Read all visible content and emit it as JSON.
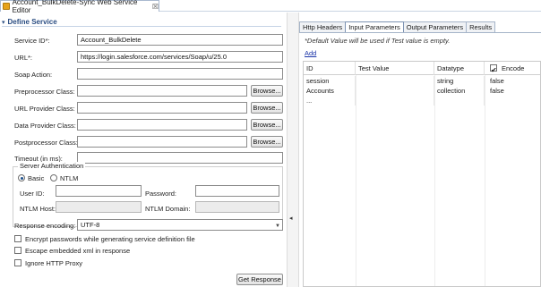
{
  "editor": {
    "tab_title": "Account_BulkDelete-Sync Web Service Editor",
    "close_glyph": "☒"
  },
  "section": {
    "title": "Define Service",
    "chevron": "▾"
  },
  "fields": {
    "service_id_label": "Service ID*:",
    "service_id_value": "Account_BulkDelete",
    "url_label": "URL*:",
    "url_value": "https://login.salesforce.com/services/Soap/u/25.0",
    "soap_action_label": "Soap Action:",
    "soap_action_value": "",
    "preprocessor_label": "Preprocessor Class:",
    "preprocessor_value": "",
    "url_provider_label": "URL Provider Class:",
    "url_provider_value": "",
    "data_provider_label": "Data Provider Class:",
    "data_provider_value": "",
    "postprocessor_label": "Postprocessor Class:",
    "postprocessor_value": "",
    "timeout_label": "Timeout (in ms):",
    "timeout_value": "",
    "browse_label": "Browse..."
  },
  "auth": {
    "group_title": "Server Authentication",
    "basic_label": "Basic",
    "ntlm_label": "NTLM",
    "selected": "Basic",
    "user_id_label": "User ID:",
    "password_label": "Password:",
    "ntlm_host_label": "NTLM Host:",
    "ntlm_domain_label": "NTLM Domain:"
  },
  "encoding": {
    "label": "Response encoding:",
    "value": "UTF-8"
  },
  "options": {
    "encrypt_label": "Encrypt passwords while generating service definition file",
    "encrypt_checked": false,
    "escape_label": "Escape embedded xml in response",
    "escape_checked": false,
    "ignore_proxy_label": "Ignore HTTP Proxy",
    "ignore_proxy_checked": false
  },
  "get_response_label": "Get Response",
  "right_tabs": [
    "Http Headers",
    "Input Parameters",
    "Output Parameters",
    "Results"
  ],
  "active_right_tab": "Input Parameters",
  "note": "*Default Value will be used if Test value is empty.",
  "add_link": "Add",
  "grid": {
    "columns": [
      "ID",
      "Test Value",
      "Datatype",
      "Encode"
    ],
    "encode_header_checked": true,
    "rows": [
      {
        "id": "session",
        "test_value": "",
        "datatype": "string",
        "encode": "false"
      },
      {
        "id": "Accounts",
        "test_value": "",
        "datatype": "collection",
        "encode": "false"
      },
      {
        "id": "...",
        "test_value": "",
        "datatype": "",
        "encode": ""
      }
    ]
  },
  "sash_arrow": "◂",
  "icons": {
    "editor_tab": "service-editor-icon",
    "select_arrow": "chevron-down-icon"
  }
}
